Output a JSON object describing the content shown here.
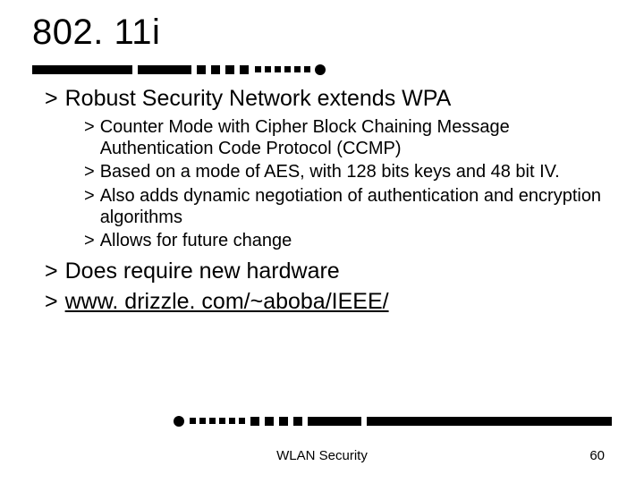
{
  "title": "802. 11i",
  "bullets": {
    "b1": "Robust Security Network extends WPA",
    "sub": {
      "s1": "Counter Mode with Cipher Block Chaining Message Authentication Code Protocol (CCMP)",
      "s2": "Based on a mode of AES, with 128 bits keys and 48 bit IV.",
      "s3": "Also adds dynamic negotiation of authentication and encryption algorithms",
      "s4": "Allows for future change"
    },
    "b2": "Does require new hardware",
    "b3": "www. drizzle. com/~aboba/IEEE/"
  },
  "footer": {
    "center": "WLAN Security",
    "page": "60"
  },
  "glyphs": {
    "gt": ">"
  }
}
